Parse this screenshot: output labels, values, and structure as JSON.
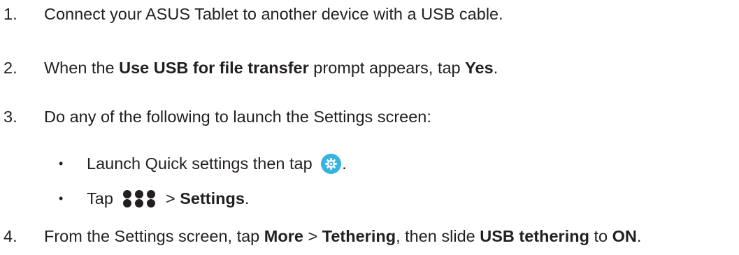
{
  "steps": [
    {
      "number": "1.",
      "text": "Connect your ASUS Tablet to another device with a USB cable."
    },
    {
      "number": "2.",
      "pre": "When the ",
      "bold1": "Use USB for file transfer",
      "mid": " prompt appears, tap ",
      "bold2": "Yes",
      "post": "."
    },
    {
      "number": "3.",
      "text": "Do any of the following to launch the Settings screen:",
      "bullets": [
        {
          "bullet": "•",
          "pre": "Launch Quick settings then tap ",
          "icon": "settings-gear-icon",
          "post": "."
        },
        {
          "bullet": "•",
          "pre": "Tap ",
          "icon": "all-apps-dots-icon",
          "mid": " > ",
          "bold": "Settings",
          "post": "."
        }
      ]
    },
    {
      "number": "4.",
      "pre": "From the Settings screen, tap ",
      "bold1": "More",
      "sep": " > ",
      "bold2": "Tethering",
      "mid": ", then slide ",
      "bold3": "USB tethering",
      "mid2": " to ",
      "bold4": "ON",
      "post": "."
    }
  ],
  "colors": {
    "text": "#231f20",
    "gear_background": "#36b3e0",
    "gear_foreground": "#ffffff"
  }
}
